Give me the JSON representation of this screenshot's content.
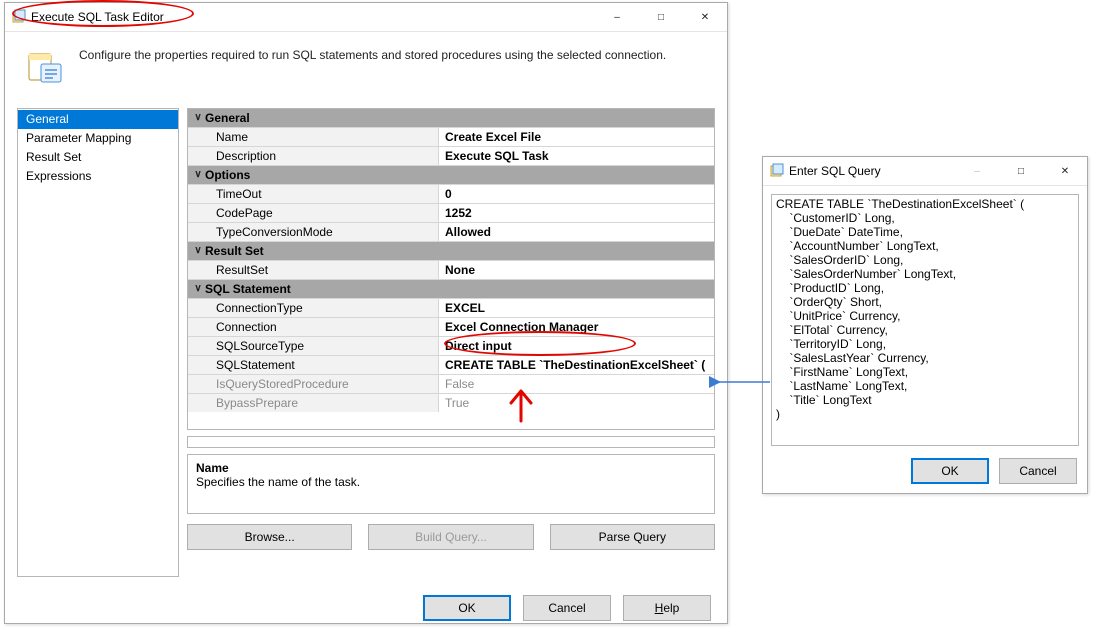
{
  "main": {
    "title": "Execute SQL Task Editor",
    "desc": "Configure the properties required to run SQL statements and stored procedures using the selected connection.",
    "nav": {
      "items": [
        "General",
        "Parameter Mapping",
        "Result Set",
        "Expressions"
      ],
      "selected": 0
    },
    "grid": {
      "cats": [
        {
          "label": "General",
          "rows": [
            {
              "name": "Name",
              "value": "Create Excel File"
            },
            {
              "name": "Description",
              "value": "Execute SQL Task"
            }
          ]
        },
        {
          "label": "Options",
          "rows": [
            {
              "name": "TimeOut",
              "value": "0"
            },
            {
              "name": "CodePage",
              "value": "1252"
            },
            {
              "name": "TypeConversionMode",
              "value": "Allowed"
            }
          ]
        },
        {
          "label": "Result Set",
          "rows": [
            {
              "name": "ResultSet",
              "value": "None"
            }
          ]
        },
        {
          "label": "SQL Statement",
          "rows": [
            {
              "name": "ConnectionType",
              "value": "EXCEL"
            },
            {
              "name": "Connection",
              "value": "Excel Connection Manager"
            },
            {
              "name": "SQLSourceType",
              "value": "Direct input"
            },
            {
              "name": "SQLStatement",
              "value": "CREATE TABLE `TheDestinationExcelSheet` ("
            },
            {
              "name": "IsQueryStoredProcedure",
              "value": "False",
              "disabled": true
            },
            {
              "name": "BypassPrepare",
              "value": "True",
              "disabled": true
            }
          ]
        }
      ]
    },
    "info": {
      "title": "Name",
      "text": "Specifies the name of the task."
    },
    "buttons": {
      "browse": "Browse...",
      "build": "Build Query...",
      "parse": "Parse Query"
    },
    "bottom": {
      "ok": "OK",
      "cancel": "Cancel",
      "help_u": "H",
      "help_rest": "elp"
    }
  },
  "sql": {
    "title": "Enter SQL Query",
    "query": "CREATE TABLE `TheDestinationExcelSheet` (\n    `CustomerID` Long,\n    `DueDate` DateTime,\n    `AccountNumber` LongText,\n    `SalesOrderID` Long,\n    `SalesOrderNumber` LongText,\n    `ProductID` Long,\n    `OrderQty` Short,\n    `UnitPrice` Currency,\n    `ElTotal` Currency,\n    `TerritoryID` Long,\n    `SalesLastYear` Currency,\n    `FirstName` LongText,\n    `LastName` LongText,\n    `Title` LongText\n)",
    "ok": "OK",
    "cancel": "Cancel"
  }
}
